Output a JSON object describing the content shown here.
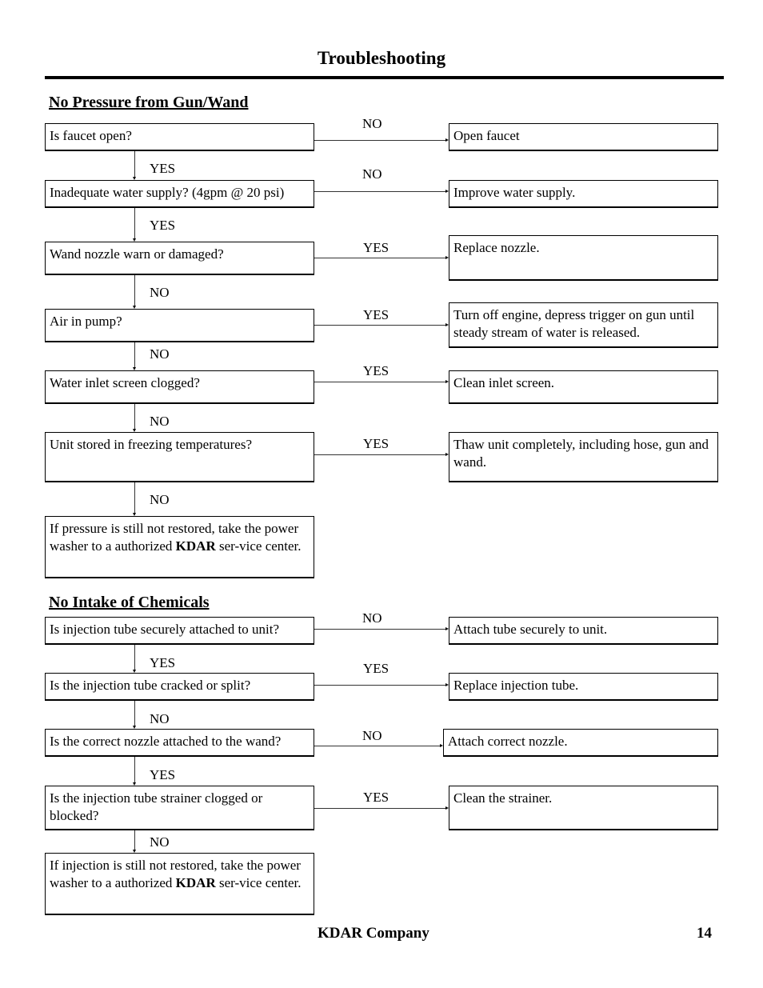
{
  "page": {
    "title": "Troubleshooting",
    "footer_company": "KDAR Company",
    "page_number": "14"
  },
  "sections": [
    {
      "heading": "No Pressure from Gun/Wand",
      "steps": [
        {
          "question": "Is faucet open?",
          "branch_label": "NO",
          "action": "Open faucet",
          "down_label": "YES"
        },
        {
          "question": "Inadequate water supply? (4gpm @ 20 psi)",
          "branch_label": "NO",
          "action": "Improve water supply.",
          "down_label": "YES"
        },
        {
          "question": "Wand nozzle warn or damaged?",
          "branch_label": "YES",
          "action": "Replace nozzle.",
          "down_label": "NO"
        },
        {
          "question": "Air in pump?",
          "branch_label": "YES",
          "action": "Turn off engine, depress trigger on gun until steady stream of water is released.",
          "down_label": "NO"
        },
        {
          "question": "Water inlet screen clogged?",
          "branch_label": "YES",
          "action": "Clean inlet screen.",
          "down_label": "NO"
        },
        {
          "question": "Unit stored in freezing temperatures?",
          "branch_label": "YES",
          "action": "Thaw unit completely, including hose, gun and wand.",
          "down_label": "NO"
        }
      ],
      "final": {
        "before": "If pressure is still not restored, take the power washer to a authorized ",
        "brand": "KDAR",
        "after": " ser-vice center."
      }
    },
    {
      "heading": "No Intake of Chemicals",
      "steps": [
        {
          "question": "Is injection tube securely attached to unit?",
          "branch_label": "NO",
          "action": "Attach tube securely to unit.",
          "down_label": "YES"
        },
        {
          "question": "Is the injection tube cracked or split?",
          "branch_label": "YES",
          "action": "Replace injection tube.",
          "down_label": "NO"
        },
        {
          "question": "Is the correct nozzle attached to the wand?",
          "branch_label": "NO",
          "action": "Attach correct nozzle.",
          "down_label": "YES"
        },
        {
          "question": "Is the injection tube strainer clogged or blocked?",
          "branch_label": "YES",
          "action": "Clean the strainer.",
          "down_label": "NO"
        }
      ],
      "final": {
        "before": "If injection is still not restored, take the power washer to a authorized ",
        "brand": "KDAR",
        "after": " ser-vice center."
      }
    }
  ]
}
